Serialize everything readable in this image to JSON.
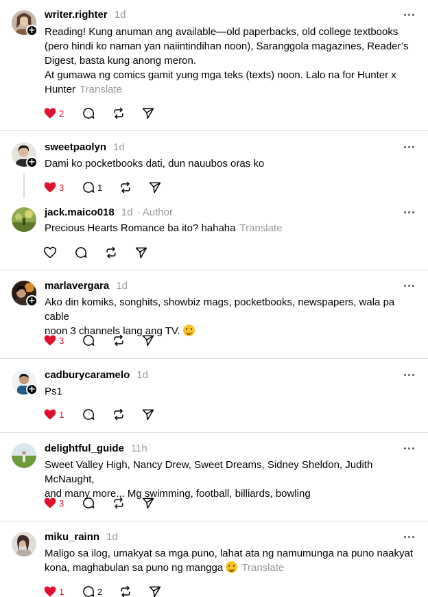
{
  "icons": {
    "like": "heart-icon",
    "comment": "comment-bubble-icon",
    "repost": "repost-icon",
    "share": "send-icon",
    "more": "more-dots-icon"
  },
  "colors": {
    "liked": "#e0102f",
    "muted": "#999999",
    "divider": "#dbdbdb"
  },
  "posts": [
    {
      "username": "writer.righter",
      "time": "1d",
      "lines": [
        "Reading! Kung anuman ang available—old paperbacks, old college textbooks",
        "(pero hindi ko naman yan naiintindihan noon), Saranggola magazines, Reader’s",
        "Digest, basta kung anong meron.",
        "At gumawa ng comics gamit yung mga teks (texts) noon. Lalo na for Hunter x",
        "Hunter"
      ],
      "translate": "Translate",
      "likes": "2",
      "comments": ""
    },
    {
      "username": "sweetpaolyn",
      "time": "1d",
      "lines": [
        "Dami ko pocketbooks dati, dun nauubos oras ko"
      ],
      "likes": "3",
      "comments": "1"
    },
    {
      "username": "jack.maico018",
      "time": "1d",
      "author": "· Author",
      "lines": [
        "Precious Hearts Romance ba ito? hahaha"
      ],
      "translate": "Translate",
      "likes": "",
      "comments": ""
    },
    {
      "username": "marlavergara",
      "time": "1d",
      "lines": [
        "Ako din komiks, songhits, showbiz mags, pocketbooks, newspapers, wala pa cable",
        "noon 3 channels lang ang TV."
      ],
      "emoji": "hugging-face",
      "likes": "3",
      "comments": ""
    },
    {
      "username": "cadburycaramelo",
      "time": "1d",
      "lines": [
        "Ps1"
      ],
      "likes": "1",
      "comments": ""
    },
    {
      "username": "delightful_guide",
      "time": "11h",
      "lines": [
        "Sweet Valley High, Nancy Drew, Sweet Dreams, Sidney Sheldon, Judith McNaught,",
        "and many more... Mg swimming, football, billiards, bowling"
      ],
      "likes": "3",
      "comments": ""
    },
    {
      "username": "miku_rainn",
      "time": "1d",
      "lines": [
        "Maligo sa ilog, umakyat sa mga puno, lahat ata ng namumunga na puno naakyat",
        "kona, maghabulan sa puno ng mangga"
      ],
      "emoji": "grinning-sweat",
      "translate": "Translate",
      "likes": "1",
      "comments": "2"
    }
  ]
}
